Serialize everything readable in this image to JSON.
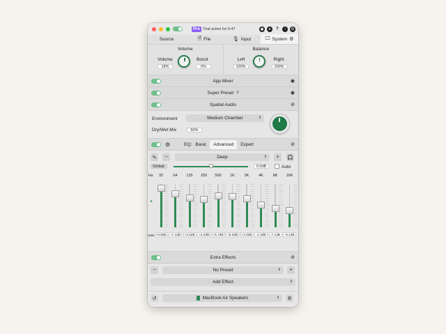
{
  "title_bar": {
    "pro_badge": "Pro",
    "trial_text": "Trial active for 6:47"
  },
  "tabs": [
    {
      "label": "Source"
    },
    {
      "label": "File"
    },
    {
      "label": "Input"
    },
    {
      "label": "System"
    }
  ],
  "volume": {
    "title": "Volume",
    "volume_label": "Volume",
    "volume_value": "18%",
    "boost_label": "Boost",
    "boost_value": "0%"
  },
  "balance": {
    "title": "Balance",
    "left_label": "Left",
    "left_value": "100%",
    "right_label": "Right",
    "right_value": "100%"
  },
  "app_mixer": {
    "title": "App Mixer"
  },
  "super_preset": {
    "title": "Super Preset",
    "help": "?"
  },
  "spatial_audio": {
    "title": "Spatial Audio",
    "environment_label": "Environment",
    "environment_value": "Medium Chamber",
    "drywet_label": "Dry/Wet Mix",
    "drywet_value": "50%"
  },
  "eq": {
    "label": "EQ:",
    "tabs": [
      "Basic",
      "Advanced",
      "Expert"
    ],
    "preset": "Deep",
    "global_label": "Global:",
    "global_value": "0.0dB",
    "global_level": 0.5,
    "auto_label": "Auto",
    "hz_label": "Hz",
    "gain_label": "Gain",
    "bands": [
      {
        "freq": "32",
        "gain": "+9.9dB",
        "level": 0.9
      },
      {
        "freq": "64",
        "gain": "+7.1dB",
        "level": 0.77
      },
      {
        "freq": "125",
        "gain": "+3.5dB",
        "level": 0.67
      },
      {
        "freq": "250",
        "gain": "+2.0dB",
        "level": 0.65
      },
      {
        "freq": "500",
        "gain": "+5.7dB",
        "level": 0.72
      },
      {
        "freq": "1K",
        "gain": "+5.0dB",
        "level": 0.71
      },
      {
        "freq": "2K",
        "gain": "+2.9dB",
        "level": 0.66
      },
      {
        "freq": "4K",
        "gain": "-4.3dB",
        "level": 0.52
      },
      {
        "freq": "8K",
        "gain": "-7.1dB",
        "level": 0.44
      },
      {
        "freq": "16K",
        "gain": "-9.1dB",
        "level": 0.38
      }
    ]
  },
  "extra_effects": {
    "title": "Extra Effects",
    "preset_value": "No Preset",
    "add_effect_label": "Add Effect"
  },
  "output": {
    "device": "MacBook Air Speakers"
  },
  "colors": {
    "accent_green": "#2e8a56",
    "pro_purple": "#8b5cf6"
  }
}
